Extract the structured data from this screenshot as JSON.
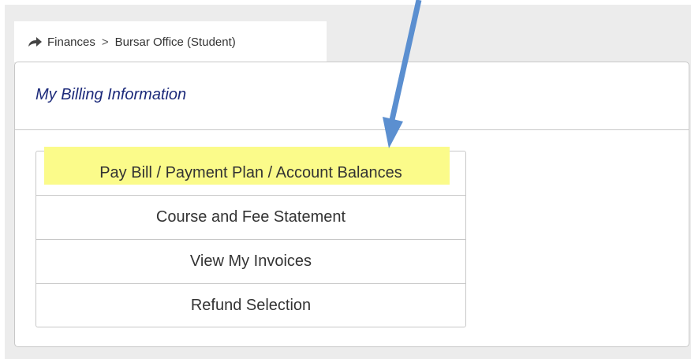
{
  "breadcrumb": {
    "items": [
      "Finances",
      "Bursar Office (Student)"
    ],
    "separator": ">",
    "icon": "share-arrow-icon"
  },
  "panel": {
    "title": "My Billing Information"
  },
  "menu": {
    "items": [
      {
        "label": "Pay Bill / Payment Plan / Account Balances",
        "highlighted": true
      },
      {
        "label": "Course and Fee Statement"
      },
      {
        "label": "View My Invoices"
      },
      {
        "label": "Refund Selection"
      }
    ]
  },
  "colors": {
    "title": "#1c2a7a",
    "highlight": "#fbfb8a",
    "annotation_arrow": "#5b8fd0",
    "background": "#ececec"
  },
  "annotation": {
    "icon": "annotation-arrow-icon"
  }
}
